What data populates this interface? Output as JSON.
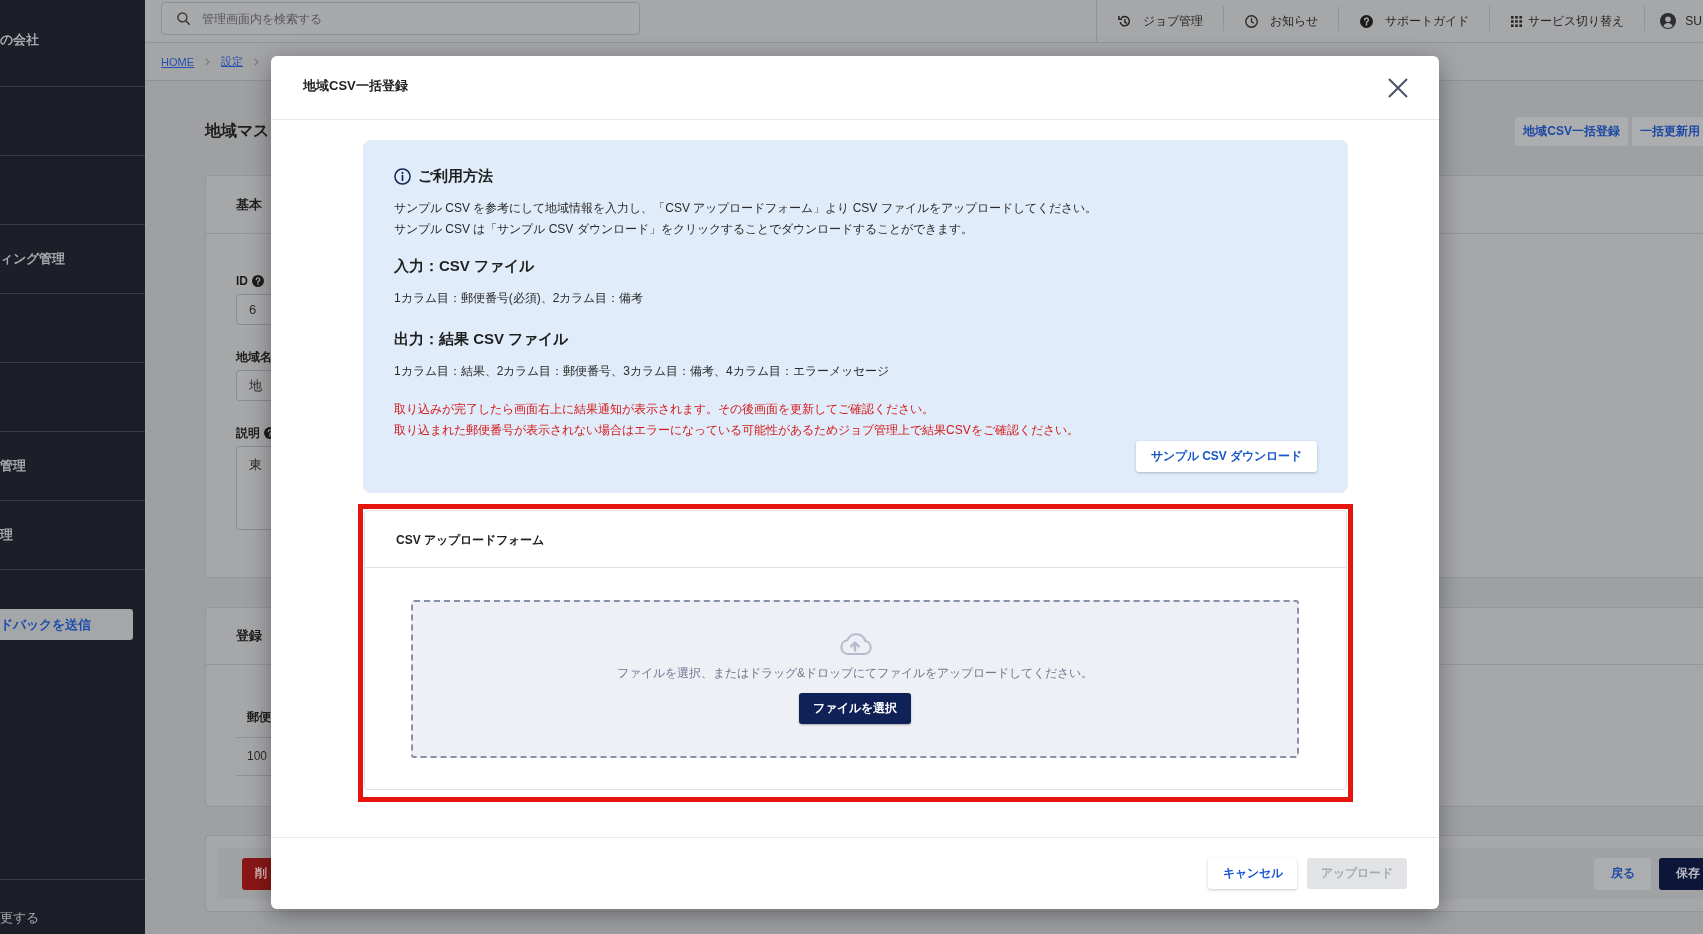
{
  "sidebar": {
    "items": [
      {
        "kind": "text",
        "label": "の会社"
      },
      {
        "kind": "clipped"
      },
      {
        "kind": "clipped"
      },
      {
        "kind": "text",
        "label": "ィング管理"
      },
      {
        "kind": "clipped"
      },
      {
        "kind": "clipped"
      },
      {
        "kind": "text",
        "label": "管理"
      },
      {
        "kind": "text",
        "label": "理"
      }
    ],
    "feedback_button": "ドバックを送信",
    "footer_item": "更する"
  },
  "header": {
    "search": {
      "placeholder": "管理画面内を検索する"
    },
    "nav": [
      {
        "label": "ジョブ管理",
        "kind": "jobs"
      },
      {
        "label": "お知らせ",
        "kind": "news"
      },
      {
        "label": "サポートガイド",
        "kind": "guide"
      },
      {
        "label": "サービス切り替え",
        "kind": "apps"
      }
    ],
    "user": {
      "name": "SU"
    }
  },
  "breadcrumb": [
    {
      "label": "HOME"
    },
    {
      "label": "設定"
    }
  ],
  "page": {
    "title": "地域マス",
    "actions": [
      "地域CSV一括登録",
      "一括更新用"
    ]
  },
  "basic_card": {
    "title": "基本",
    "fields": [
      {
        "label": "ID",
        "help": true,
        "kind": "input",
        "value": "6"
      },
      {
        "label": "地域名",
        "kind": "input",
        "value": "地"
      },
      {
        "label": "説明",
        "help": true,
        "kind": "textarea",
        "value": "東"
      }
    ]
  },
  "region_card": {
    "title": "登録",
    "table": {
      "columns": [
        "郵便"
      ],
      "rows": [
        [
          "100"
        ]
      ]
    }
  },
  "form_actions": {
    "delete": "削",
    "back": "戻る",
    "save": "保存"
  },
  "modal": {
    "title": "地域CSV一括登録",
    "usage": {
      "heading": "ご利用方法",
      "paragraphs": [
        "サンプル CSV を参考にして地域情報を入力し、「CSV アップロードフォーム」より CSV ファイルをアップロードしてください。",
        "サンプル CSV は「サンプル CSV ダウンロード」をクリックすることでダウンロードすることができます。"
      ],
      "sections": [
        {
          "heading": "入力：CSV ファイル",
          "text": "1カラム目：郵便番号(必須)、2カラム目：備考"
        },
        {
          "heading": "出力：結果 CSV ファイル",
          "text": "1カラム目：結果、2カラム目：郵便番号、3カラム目：備考、4カラム目：エラーメッセージ"
        }
      ],
      "notes": [
        "取り込みが完了したら画面右上に結果通知が表示されます。その後画面を更新してご確認ください。",
        "取り込まれた郵便番号が表示されない場合はエラーになっている可能性があるためジョブ管理上で結果CSVをご確認ください。"
      ],
      "download_button": "サンプル CSV ダウンロード"
    },
    "upload_form": {
      "title": "CSV アップロードフォーム",
      "highlighted": true,
      "hint": "ファイルを選択、またはドラッグ&ドロップにてファイルをアップロードしてください。",
      "select_button": "ファイルを選択"
    },
    "buttons": [
      {
        "label": "キャンセル",
        "disabled": false
      },
      {
        "label": "アップロード",
        "disabled": true
      }
    ]
  }
}
